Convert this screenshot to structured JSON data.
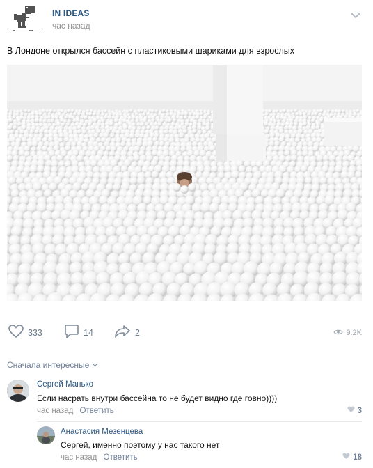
{
  "post": {
    "group_name": "IN IDEAS",
    "time": "час назад",
    "text": "В Лондоне открылся бассейн с пластиковыми шариками для взрослых",
    "likes": "333",
    "comments": "14",
    "shares": "2",
    "views": "9.2K"
  },
  "comments_section": {
    "sort_label": "Сначала интересные",
    "items": [
      {
        "author": "Сергей Манько",
        "text": "Если насрать внутри бассейна то не будет видно где говно))))",
        "time": "час назад",
        "reply_label": "Ответить",
        "likes": "3"
      },
      {
        "author": "Анастасия Мезенцева",
        "text": "Сергей, именно поэтому у нас такого нет",
        "time": "час назад",
        "reply_label": "Ответить",
        "likes": "18"
      }
    ]
  },
  "icons": {
    "avatar": "dino-pixel-icon",
    "menu": "chevron-down-icon",
    "like": "heart-icon",
    "comment": "comment-bubble-icon",
    "share": "share-arrow-icon",
    "views": "eye-icon"
  },
  "colors": {
    "link_blue": "#2a5885",
    "secondary_gray": "#939393",
    "action_gray": "#6b7b8c"
  }
}
